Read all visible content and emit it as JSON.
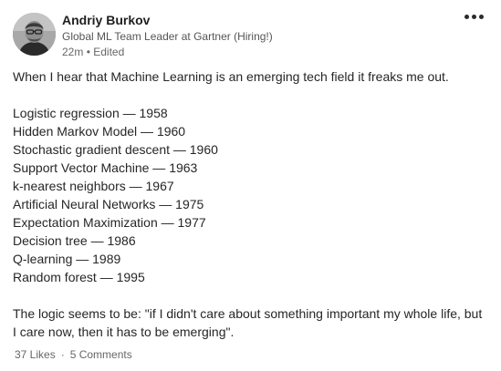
{
  "author": {
    "name": "Andriy Burkov",
    "headline": "Global ML Team Leader at Gartner (Hiring!)",
    "time": "22m",
    "separator": "•",
    "edited": "Edited"
  },
  "post": {
    "intro": "When I hear that Machine Learning is an emerging tech field it freaks me out.",
    "items": [
      "Logistic regression — 1958",
      "Hidden Markov Model — 1960",
      "Stochastic gradient descent — 1960",
      "Support Vector Machine — 1963",
      "k-nearest neighbors — 1967",
      "Artificial Neural Networks — 1975",
      "Expectation Maximization — 1977",
      "Decision tree — 1986",
      "Q-learning — 1989",
      "Random forest — 1995"
    ],
    "closing_line_1": "The logic seems to be: \"if I didn't care about something important my whole life, but",
    "closing_line_2": "I care now, then it has to be emerging\"."
  },
  "social": {
    "likes": "37 Likes",
    "separator": "·",
    "comments": "5 Comments"
  },
  "icons": {
    "more": "more-horizontal-icon"
  }
}
